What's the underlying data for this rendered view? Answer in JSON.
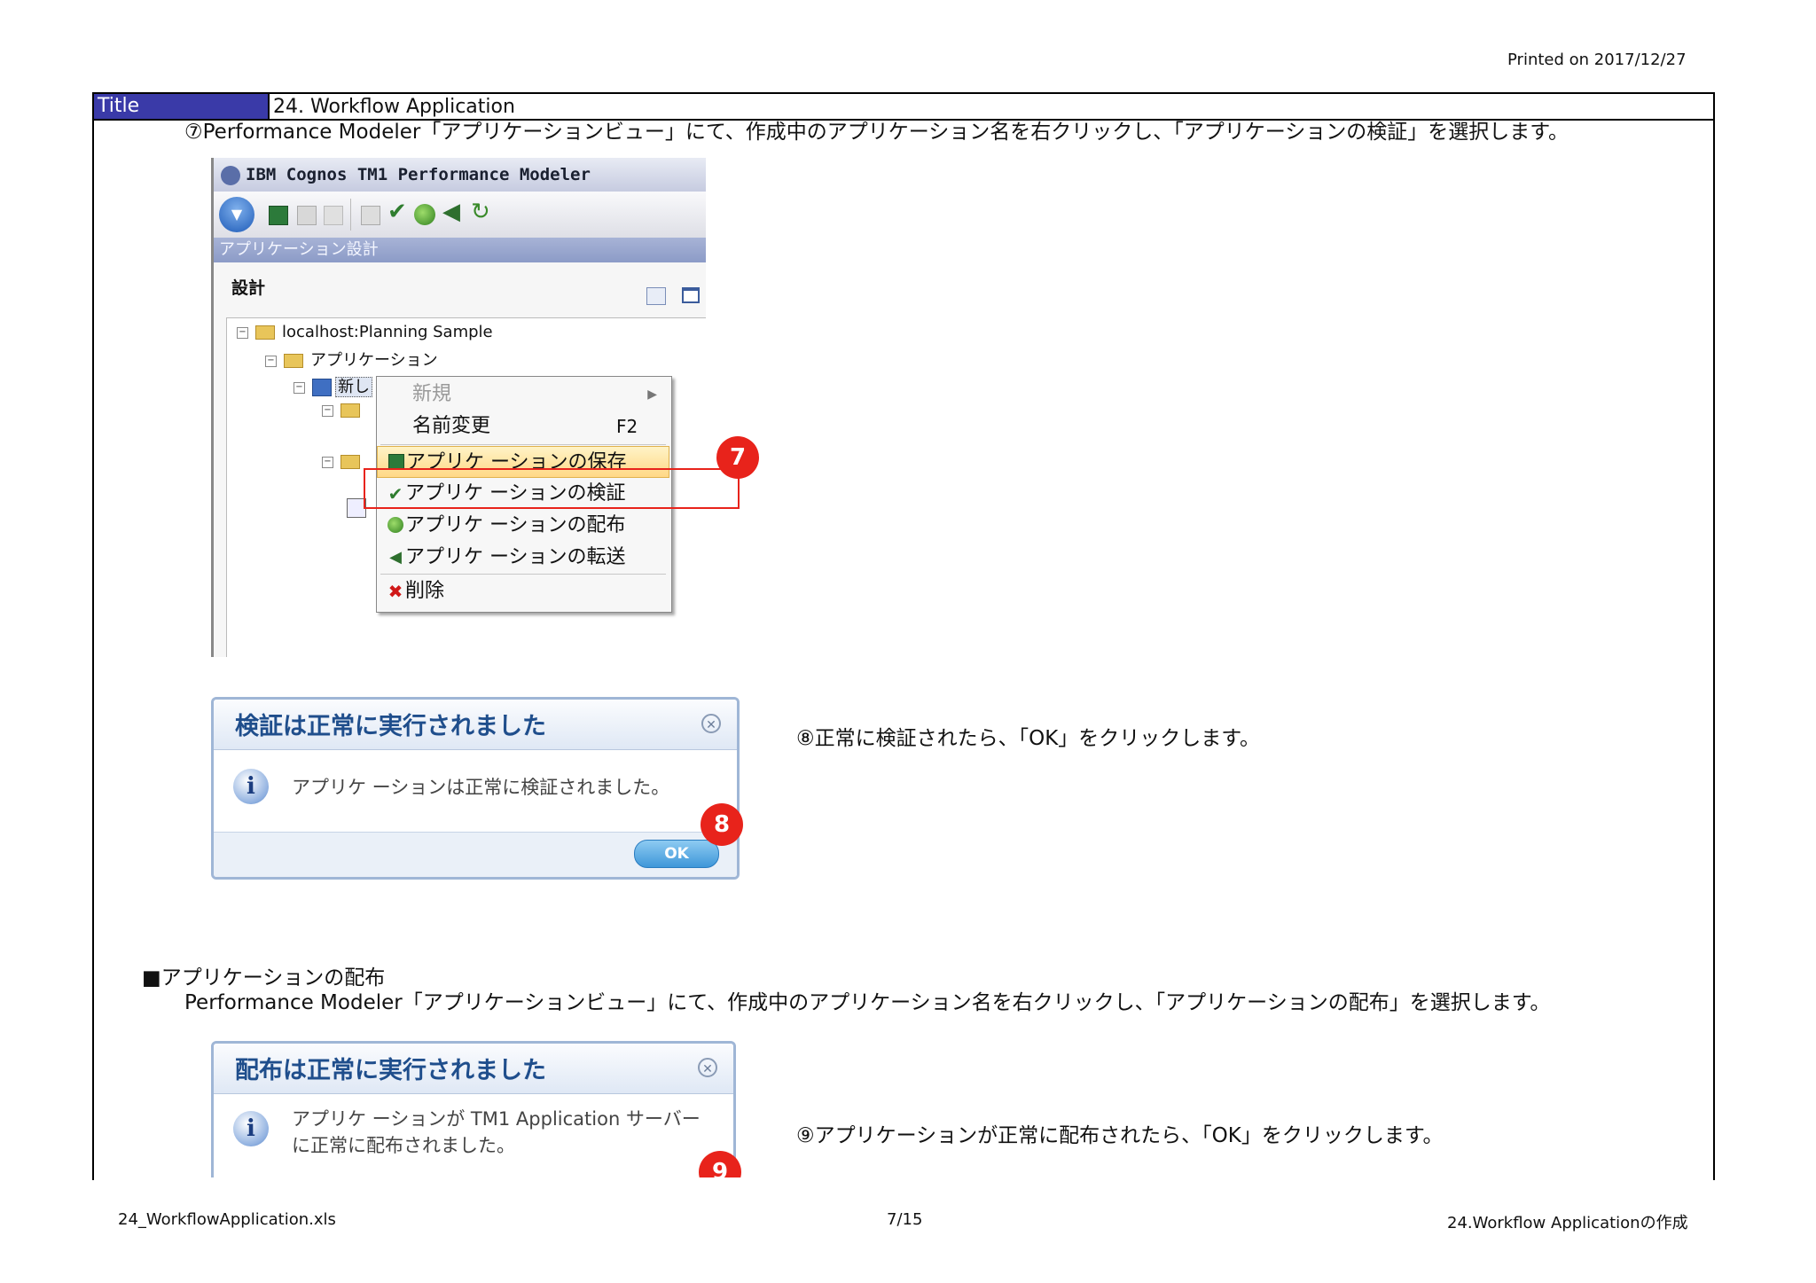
{
  "header": {
    "printed": "Printed on 2017/12/27"
  },
  "title_row": {
    "label": "Title",
    "value": "24. Workflow Application"
  },
  "steps": {
    "step7": "⑦Performance Modeler「アプリケーションビュー」にて、作成中のアプリケーション名を右クリックし、「アプリケーションの検証」を選択します。",
    "step8": "⑧正常に検証されたら、「OK」をクリックします。",
    "section_heading": "■アプリケーションの配布",
    "section_desc": "Performance Modeler「アプリケーションビュー」にて、作成中のアプリケーション名を右クリックし、「アプリケーションの配布」を選択します。",
    "step9": "⑨アプリケーションが正常に配布されたら、「OK」をクリックします。"
  },
  "modeler": {
    "window_title": "IBM Cognos TM1 Performance Modeler",
    "tab": "アプリケーション設計",
    "panel_title": "設計",
    "tree": {
      "root": "localhost:Planning Sample",
      "child": "アプリケーション",
      "selected": "新し"
    },
    "context_menu": [
      {
        "label": "新規",
        "icon": "none",
        "disabled": true
      },
      {
        "label": "名前変更",
        "shortcut": "F2",
        "icon": "none"
      },
      {
        "label": "アプリケ ーションの保存",
        "icon": "save-icon",
        "highlighted": true
      },
      {
        "label": "アプリケ ーションの検証",
        "icon": "checkmark-icon"
      },
      {
        "label": "アプリケ ーションの配布",
        "icon": "globe-icon"
      },
      {
        "label": "アプリケ ーションの転送",
        "icon": "arrow-left-icon"
      },
      {
        "label": "削除",
        "icon": "delete-icon"
      }
    ]
  },
  "badges": {
    "b7": "7",
    "b8": "8",
    "b9": "9"
  },
  "dialog_validate": {
    "title": "検証は正常に実行されました",
    "message": "アプリケ ーションは正常に検証されました。",
    "ok": "OK"
  },
  "dialog_deploy": {
    "title": "配布は正常に実行されました",
    "message_line1": "アプリケ ーションが TM1 Application サーバー",
    "message_line2": "に正常に配布されました。"
  },
  "footer": {
    "left": "24_WorkflowApplication.xls",
    "center": "7/15",
    "right": "24.Workflow Applicationの作成"
  },
  "colors": {
    "accent_red": "#e8231b",
    "title_bg": "#3a3aa8",
    "dialog_title": "#1f4e8c"
  }
}
